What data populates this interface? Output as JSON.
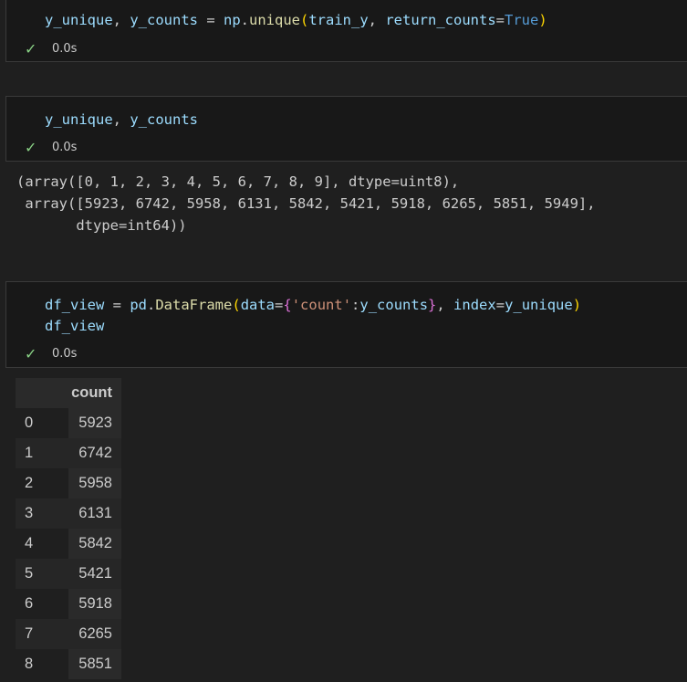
{
  "cells": [
    {
      "code_lines": [
        [
          "y_unique",
          ", ",
          "y_counts",
          " = ",
          "np",
          ".",
          "unique",
          "(",
          "train_y",
          ", ",
          "return_counts",
          "=",
          "True",
          ")"
        ]
      ],
      "status_time": "0.0s"
    },
    {
      "code_lines": [
        [
          "y_unique",
          ", ",
          "y_counts"
        ]
      ],
      "status_time": "0.0s",
      "output_lines": [
        "(array([0, 1, 2, 3, 4, 5, 6, 7, 8, 9], dtype=uint8),",
        " array([5923, 6742, 5958, 6131, 5842, 5421, 5918, 6265, 5851, 5949],",
        "       dtype=int64))"
      ]
    },
    {
      "code_lines": [
        [
          "df_view",
          " = ",
          "pd",
          ".",
          "DataFrame",
          "(",
          "data",
          "=",
          "{",
          "'count'",
          ":",
          "y_counts",
          "}",
          ", ",
          "index",
          "=",
          "y_unique",
          ")"
        ],
        [
          "df_view"
        ]
      ],
      "status_time": "0.0s",
      "dataframe": {
        "columns": [
          "count"
        ],
        "rows": [
          [
            "0",
            "5923"
          ],
          [
            "1",
            "6742"
          ],
          [
            "2",
            "5958"
          ],
          [
            "3",
            "6131"
          ],
          [
            "4",
            "5842"
          ],
          [
            "5",
            "5421"
          ],
          [
            "6",
            "5918"
          ],
          [
            "7",
            "6265"
          ],
          [
            "8",
            "5851"
          ]
        ]
      }
    }
  ],
  "colors": {
    "variable": "#9cdcfe",
    "function": "#dcdcaa",
    "bracket": "#ffd700",
    "brace": "#da70d6",
    "string": "#ce9178",
    "keyword": "#569cd6",
    "success": "#89d185"
  },
  "icons": {
    "status": "check-icon"
  }
}
